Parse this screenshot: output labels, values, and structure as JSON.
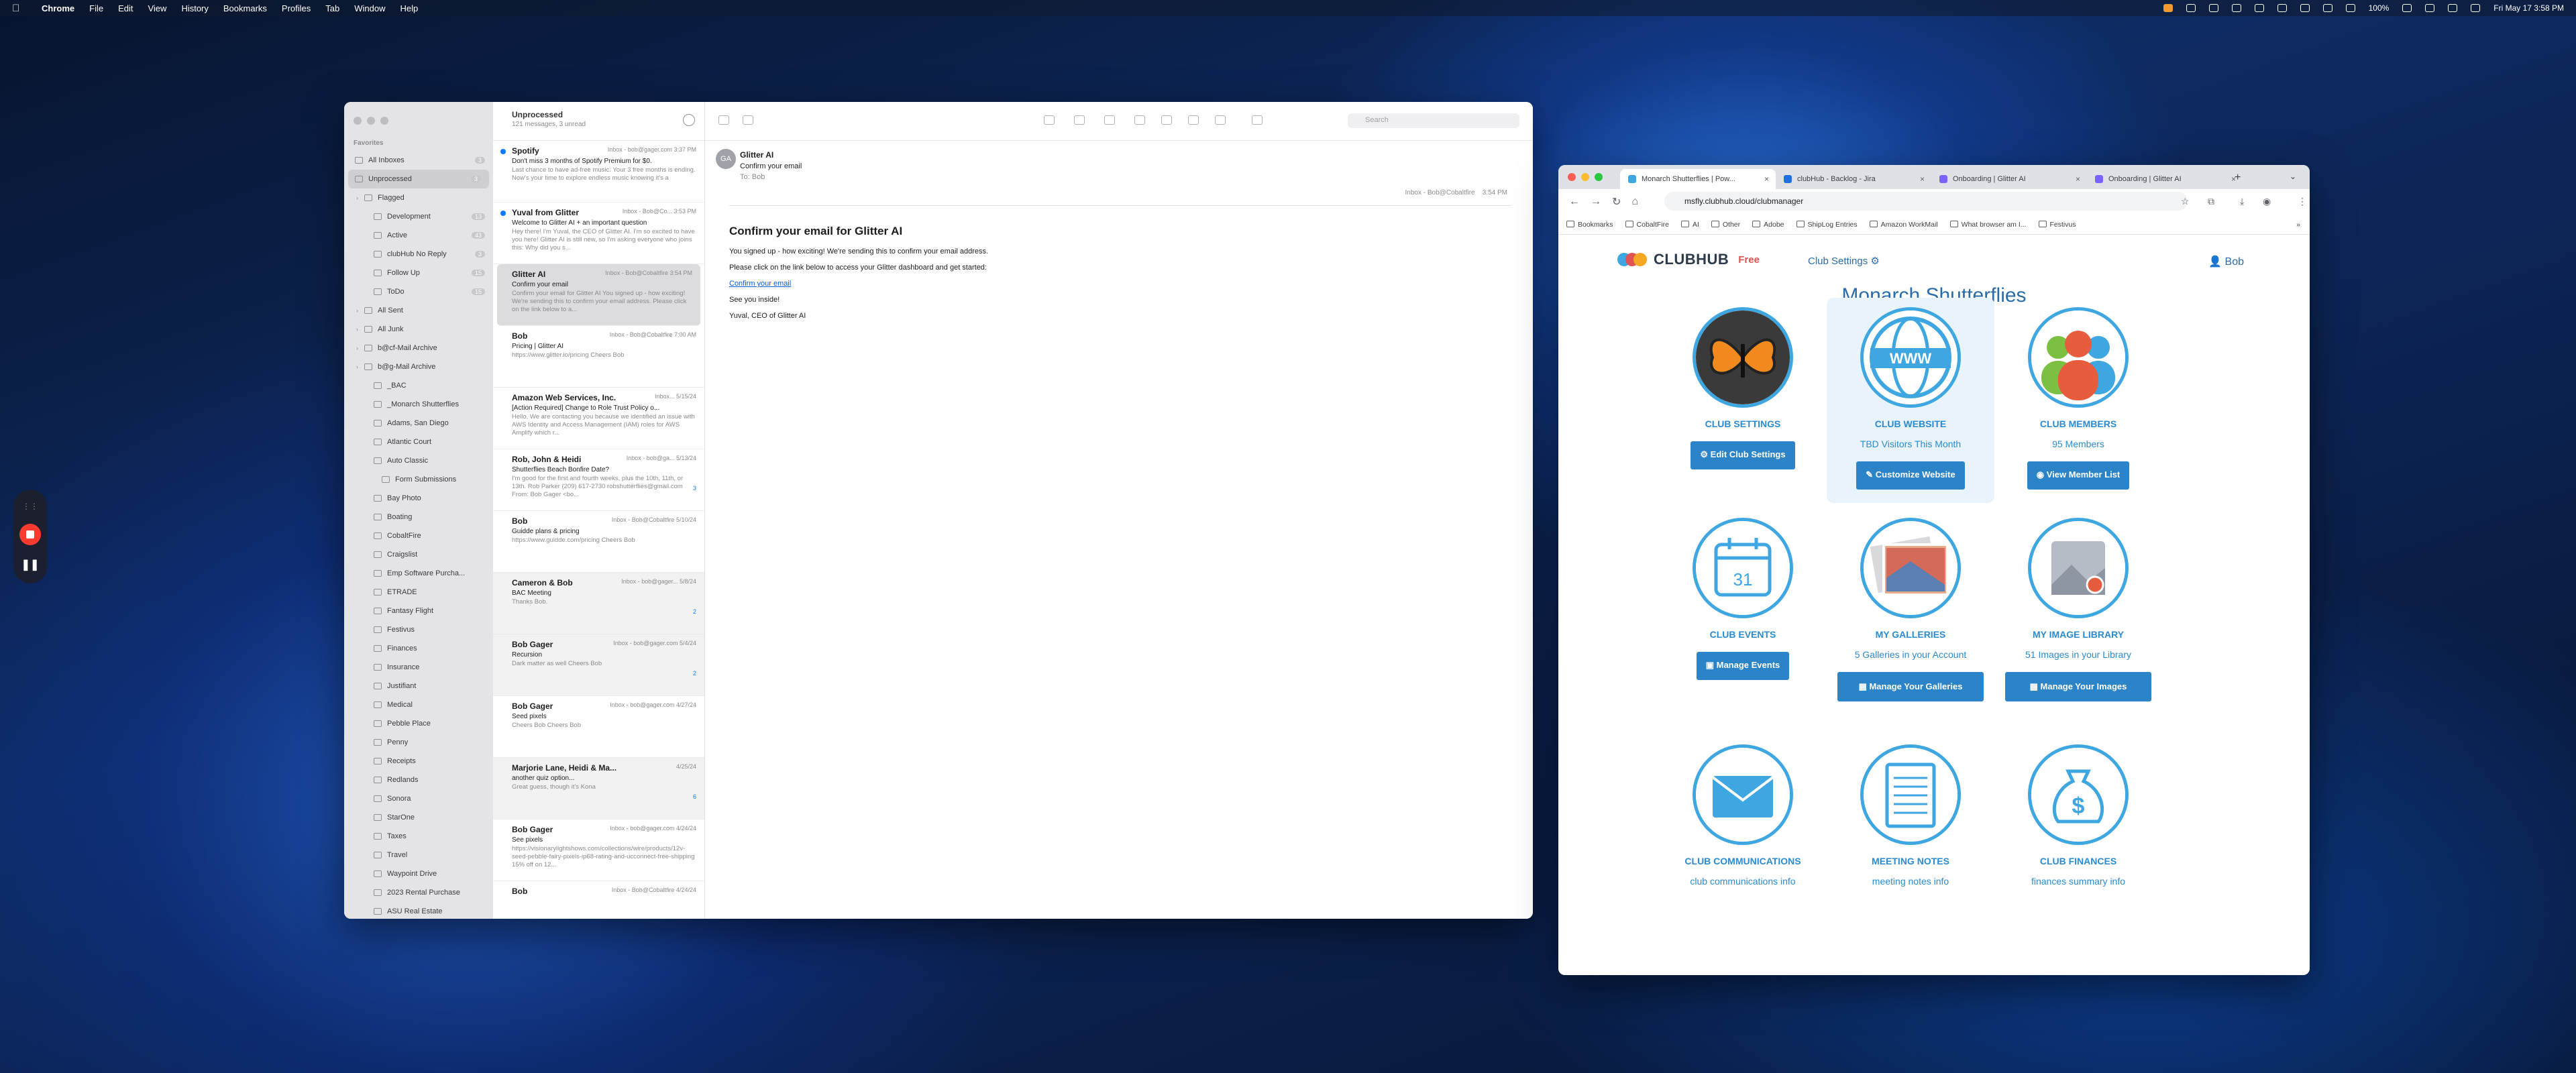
{
  "menubar": {
    "app": "Chrome",
    "items": [
      "File",
      "Edit",
      "View",
      "History",
      "Bookmarks",
      "Profiles",
      "Tab",
      "Window",
      "Help"
    ],
    "battery": "100%",
    "clock": "Fri May 17  3:58 PM"
  },
  "mail": {
    "sidebar": {
      "favorites_label": "Favorites",
      "items": [
        {
          "label": "All Inboxes",
          "count": "3",
          "sel": false,
          "level": 0
        },
        {
          "label": "Unprocessed",
          "count": "3",
          "sel": true,
          "level": 0
        },
        {
          "label": "Flagged",
          "count": "",
          "sel": false,
          "level": 0
        },
        {
          "label": "Development",
          "count": "13",
          "sel": false,
          "level": 1
        },
        {
          "label": "Active",
          "count": "43",
          "sel": false,
          "level": 1
        },
        {
          "label": "clubHub No Reply",
          "count": "3",
          "sel": false,
          "level": 1
        },
        {
          "label": "Follow Up",
          "count": "15",
          "sel": false,
          "level": 1
        },
        {
          "label": "ToDo",
          "count": "15",
          "sel": false,
          "level": 1
        },
        {
          "label": "All Sent",
          "count": "",
          "sel": false,
          "level": 0
        },
        {
          "label": "All Junk",
          "count": "",
          "sel": false,
          "level": 0
        },
        {
          "label": "b@cf-Mail Archive",
          "count": "",
          "sel": false,
          "level": 0
        },
        {
          "label": "b@g-Mail Archive",
          "count": "",
          "sel": false,
          "level": 0
        },
        {
          "label": "_BAC",
          "count": "",
          "sel": false,
          "level": 1
        },
        {
          "label": "_Monarch Shutterflies",
          "count": "",
          "sel": false,
          "level": 1
        },
        {
          "label": "Adams, San Diego",
          "count": "",
          "sel": false,
          "level": 1
        },
        {
          "label": "Atlantic Court",
          "count": "",
          "sel": false,
          "level": 1
        },
        {
          "label": "Auto Classic",
          "count": "",
          "sel": false,
          "level": 1
        },
        {
          "label": "Form Submissions",
          "count": "",
          "sel": false,
          "level": 2
        },
        {
          "label": "Bay Photo",
          "count": "",
          "sel": false,
          "level": 1
        },
        {
          "label": "Boating",
          "count": "",
          "sel": false,
          "level": 1
        },
        {
          "label": "CobaltFire",
          "count": "",
          "sel": false,
          "level": 1
        },
        {
          "label": "Craigslist",
          "count": "",
          "sel": false,
          "level": 1
        },
        {
          "label": "Emp Software Purcha...",
          "count": "",
          "sel": false,
          "level": 1
        },
        {
          "label": "ETRADE",
          "count": "",
          "sel": false,
          "level": 1
        },
        {
          "label": "Fantasy Flight",
          "count": "",
          "sel": false,
          "level": 1
        },
        {
          "label": "Festivus",
          "count": "",
          "sel": false,
          "level": 1
        },
        {
          "label": "Finances",
          "count": "",
          "sel": false,
          "level": 1
        },
        {
          "label": "Insurance",
          "count": "",
          "sel": false,
          "level": 1
        },
        {
          "label": "Justifiant",
          "count": "",
          "sel": false,
          "level": 1
        },
        {
          "label": "Medical",
          "count": "",
          "sel": false,
          "level": 1
        },
        {
          "label": "Pebble Place",
          "count": "",
          "sel": false,
          "level": 1
        },
        {
          "label": "Penny",
          "count": "",
          "sel": false,
          "level": 1
        },
        {
          "label": "Receipts",
          "count": "",
          "sel": false,
          "level": 1
        },
        {
          "label": "Redlands",
          "count": "",
          "sel": false,
          "level": 1
        },
        {
          "label": "Sonora",
          "count": "",
          "sel": false,
          "level": 1
        },
        {
          "label": "StarOne",
          "count": "",
          "sel": false,
          "level": 1
        },
        {
          "label": "Taxes",
          "count": "",
          "sel": false,
          "level": 1
        },
        {
          "label": "Travel",
          "count": "",
          "sel": false,
          "level": 1
        },
        {
          "label": "Waypoint Drive",
          "count": "",
          "sel": false,
          "level": 1
        },
        {
          "label": "2023 Rental Purchase",
          "count": "",
          "sel": false,
          "level": 1
        },
        {
          "label": "ASU Real Estate",
          "count": "",
          "sel": false,
          "level": 1
        }
      ]
    },
    "list": {
      "title": "Unprocessed",
      "subtitle": "121 messages, 3 unread",
      "messages": [
        {
          "from": "Spotify",
          "meta": "Inbox - bob@gager.com   3:37 PM",
          "subject": "Don't miss 3 months of Spotify Premium for $0.",
          "preview": "Last chance to have ad-free music. Your 3 free months is ending. Now's your time to explore endless music knowing it's a",
          "unread": true,
          "badge": ""
        },
        {
          "from": "Yuval from Glitter",
          "meta": "Inbox - Bob@Co...   3:53 PM",
          "subject": "Welcome to Glitter AI + an important question",
          "preview": "Hey there! I'm Yuval, the CEO of Glitter AI. I'm so excited to have you here! Glitter AI is still new, so I'm asking everyone who joins this: Why did you s...",
          "unread": true,
          "badge": ""
        },
        {
          "from": "Glitter AI",
          "meta": "Inbox - Bob@Cobaltfire   3:54 PM",
          "subject": "Confirm your email",
          "preview": "Confirm your email for Glitter AI You signed up - how exciting! We're sending this to confirm your email address. Please click on the link below to a...",
          "unread": false,
          "badge": "",
          "sel": true
        },
        {
          "from": "Bob",
          "meta": "Inbox - Bob@Cobaltfire   7:00 AM",
          "subject": "Pricing | Glitter AI",
          "preview": "https://www.glitter.io/pricing Cheers Bob",
          "unread": false,
          "badge": ""
        },
        {
          "from": "Amazon Web Services, Inc.",
          "meta": "Inbox...   5/15/24",
          "subject": "[Action Required] Change to Role Trust Policy o...",
          "preview": "Hello, We are contacting you because we identified an issue with AWS Identity and Access Management (IAM) roles for AWS Amplify which r...",
          "unread": false,
          "badge": ""
        },
        {
          "from": "Rob, John & Heidi",
          "meta": "Inbox - bob@ga...   5/13/24",
          "subject": "Shutterflies Beach Bonfire Date?",
          "preview": "I'm good for the first and fourth weeks, plus the 10th, 11th, or 13th. Rob Parker (209) 617-2730 robshutterflies@gmail.com From: Bob Gager <bo...",
          "unread": false,
          "badge": "3"
        },
        {
          "from": "Bob",
          "meta": "Inbox - Bob@Cobaltfire   5/10/24",
          "subject": "Guidde plans & pricing",
          "preview": "https://www.guidde.com/pricing Cheers Bob",
          "unread": false,
          "badge": ""
        },
        {
          "from": "Cameron & Bob",
          "meta": "Inbox - bob@gager...   5/8/24",
          "subject": "BAC Meeting",
          "preview": "Thanks Bob.",
          "unread": false,
          "badge": "2",
          "gray": true
        },
        {
          "from": "Bob Gager",
          "meta": "Inbox - bob@gager.com   5/4/24",
          "subject": "Recursion",
          "preview": "Dark matter as well Cheers Bob",
          "unread": false,
          "badge": "2",
          "gray": true
        },
        {
          "from": "Bob Gager",
          "meta": "Inbox - bob@gager.com   4/27/24",
          "subject": "Seed pixels",
          "preview": "Cheers Bob Cheers Bob",
          "unread": false,
          "badge": ""
        },
        {
          "from": "Marjorie Lane, Heidi & Ma...",
          "meta": "4/25/24",
          "subject": "another quiz option...",
          "preview": "Great guess, though it's Kona",
          "unread": false,
          "badge": "6",
          "gray": true
        },
        {
          "from": "Bob Gager",
          "meta": "Inbox - bob@gager.com   4/24/24",
          "subject": "See pixels",
          "preview": "https://visionarylightshows.com/collections/wire/products/12v-seed-pebble-fairy-pixels-ip68-rating-and-ucconnect-free-shipping 15% off on 12...",
          "unread": false,
          "badge": ""
        },
        {
          "from": "Bob",
          "meta": "Inbox - Bob@Cobaltfire   4/24/24",
          "subject": "",
          "preview": "",
          "unread": false,
          "badge": ""
        }
      ]
    },
    "toolbar": {
      "search_placeholder": "Search"
    },
    "viewer": {
      "avatar": "GA",
      "from": "Glitter AI",
      "subject": "Confirm your email",
      "to_label": "To:",
      "to": "Bob",
      "mailbox": "Inbox - Bob@Cobaltfire",
      "time": "3:54 PM",
      "heading": "Confirm your email for Glitter AI",
      "p1": "You signed up - how exciting! We're sending this to confirm your email address.",
      "p2": "Please click on the link below to access your Glitter dashboard and get started:",
      "link": "Confirm your email",
      "p3": "See you inside!",
      "p4": "Yuval, CEO of Glitter AI"
    }
  },
  "chrome": {
    "tabs": [
      {
        "title": "Monarch Shutterflies | Pow...",
        "active": true,
        "color": "#3ea6e1"
      },
      {
        "title": "clubHub - Backlog - Jira",
        "active": false,
        "color": "#1f6fe0"
      },
      {
        "title": "Onboarding | Glitter AI",
        "active": false,
        "color": "#7b61ff"
      },
      {
        "title": "Onboarding | Glitter AI",
        "active": false,
        "color": "#7b61ff"
      }
    ],
    "url": "msfly.clubhub.cloud/clubmanager",
    "bookmarks": [
      "Bookmarks",
      "CobaltFire",
      "AI",
      "Other",
      "Adobe",
      "ShipLog Entries",
      "Amazon WorkMail",
      "What browser am I...",
      "Festivus"
    ],
    "page": {
      "logo": "CLUBHUB",
      "plan": "Free",
      "club_settings": "Club Settings ⚙",
      "user": "Bob",
      "title": "Monarch Shutterflies",
      "tiles": [
        {
          "label": "CLUB SETTINGS",
          "sub": "",
          "button": "⚙ Edit Club Settings",
          "icon": "butterfly-icon"
        },
        {
          "label": "CLUB WEBSITE",
          "sub": "TBD Visitors This Month",
          "button": "✎ Customize Website",
          "icon": "www-globe-icon"
        },
        {
          "label": "CLUB MEMBERS",
          "sub": "95 Members",
          "button": "◉ View Member List",
          "icon": "members-icon"
        },
        {
          "label": "CLUB EVENTS",
          "sub": "",
          "button": "▣ Manage Events",
          "icon": "calendar-icon"
        },
        {
          "label": "MY GALLERIES",
          "sub": "5 Galleries in your Account",
          "button": "▦ Manage Your Galleries",
          "icon": "gallery-icon"
        },
        {
          "label": "MY IMAGE LIBRARY",
          "sub": "51 Images in your Library",
          "button": "▦ Manage Your Images",
          "icon": "image-library-icon"
        },
        {
          "label": "CLUB COMMUNICATIONS",
          "sub": "club communications info",
          "button": "",
          "icon": "envelope-icon"
        },
        {
          "label": "MEETING NOTES",
          "sub": "meeting notes info",
          "button": "",
          "icon": "notepad-icon"
        },
        {
          "label": "CLUB FINANCES",
          "sub": "finances summary info",
          "button": "",
          "icon": "money-bag-icon"
        }
      ],
      "calendar_day": "31"
    }
  },
  "colors": {
    "accent": "#2a84c7",
    "brand_blue": "#3ea6e1",
    "free_red": "#e05353"
  }
}
